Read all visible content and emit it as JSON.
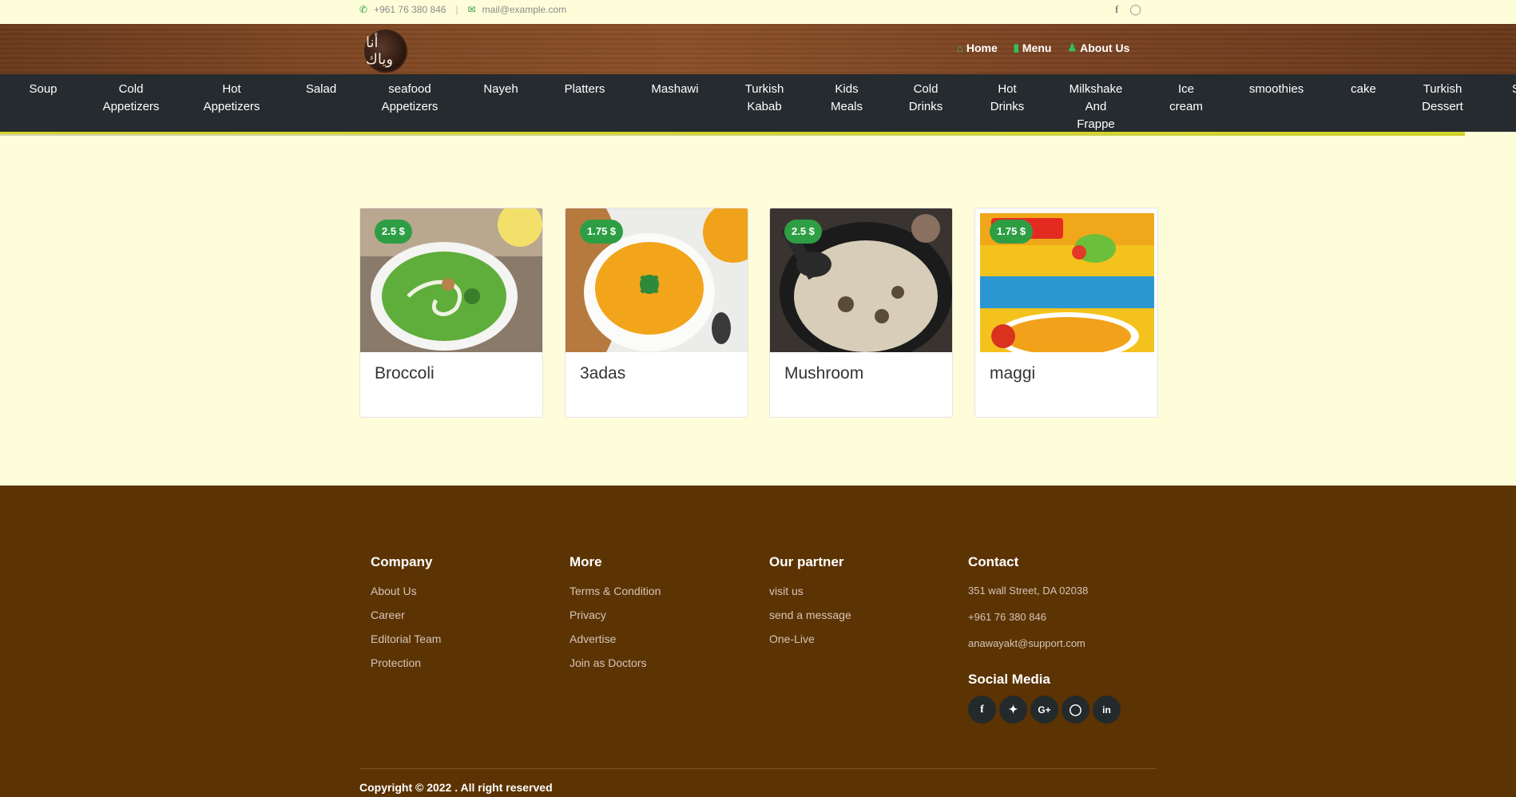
{
  "topbar": {
    "phone": "+961 76 380 846",
    "email": "mail@example.com",
    "phone_icon": "phone-icon",
    "email_icon": "mail-icon",
    "social_icons": [
      "facebook-icon",
      "instagram-icon"
    ]
  },
  "header": {
    "logo_text": "أنا وياك",
    "nav": [
      {
        "label": "Home",
        "icon": "home-icon"
      },
      {
        "label": "Menu",
        "icon": "menu-icon"
      },
      {
        "label": "About Us",
        "icon": "users-icon"
      }
    ]
  },
  "categories": [
    "Soup",
    "Cold\nAppetizers",
    "Hot\nAppetizers",
    "Salad",
    "seafood\nAppetizers",
    "Nayeh",
    "Platters",
    "Mashawi",
    "Turkish\nKabab",
    "Kids\nMeals",
    "Cold\nDrinks",
    "Hot\nDrinks",
    "Milkshake\nAnd\nFrappe",
    "Ice\ncream",
    "smoothies",
    "cake",
    "Turkish\nDessert",
    "S"
  ],
  "products": [
    {
      "name": "Broccoli",
      "price": "2.5 $"
    },
    {
      "name": "3adas",
      "price": "1.75 $"
    },
    {
      "name": "Mushroom",
      "price": "2.5 $"
    },
    {
      "name": "maggi",
      "price": "1.75 $"
    }
  ],
  "footer": {
    "company": {
      "title": "Company",
      "links": [
        "About Us",
        "Career",
        "Editorial Team",
        "Protection"
      ]
    },
    "more": {
      "title": "More",
      "links": [
        "Terms & Condition",
        "Privacy",
        "Advertise",
        "Join as Doctors"
      ]
    },
    "partner": {
      "title": "Our partner",
      "links": [
        "visit us",
        "send a message",
        "One-Live"
      ]
    },
    "contact": {
      "title": "Contact",
      "address": "351 wall Street, DA 02038",
      "phone": "+961 76 380 846",
      "email": "anawayakt@support.com"
    },
    "social": {
      "title": "Social Media",
      "icons": [
        "facebook-icon",
        "twitter-icon",
        "google-plus-icon",
        "instagram-icon",
        "linkedin-icon"
      ]
    },
    "copyright": "Copyright © 2022 . All right reserved"
  },
  "colors": {
    "accent": "#2e9e44",
    "footer_bg": "#5c3303",
    "catbar_bg": "#262b2f",
    "page_bg": "#fefdd9"
  }
}
